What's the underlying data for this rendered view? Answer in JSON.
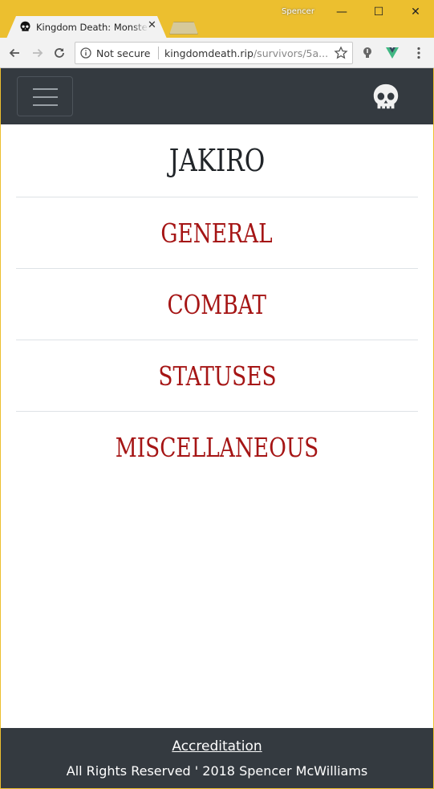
{
  "window": {
    "user": "Spencer",
    "minimize_glyph": "—",
    "maximize_glyph": "☐",
    "close_glyph": "✕"
  },
  "tab": {
    "title": "Kingdom Death: Monster",
    "close_glyph": "✕",
    "icon": "skull-icon"
  },
  "toolbar": {
    "security_label": "Not secure",
    "url_host": "kingdomdeath.rip",
    "url_path": "/survivors/5a...",
    "icons": [
      "back-arrow-icon",
      "forward-arrow-icon",
      "reload-icon",
      "info-icon",
      "star-icon",
      "lightbulb-extension-icon",
      "vue-extension-icon",
      "menu-dots-icon"
    ]
  },
  "navbar": {
    "toggle_icon": "hamburger-icon",
    "brand_icon": "skull-icon"
  },
  "survivor": {
    "name": "JAKIRO"
  },
  "menu": {
    "items": [
      {
        "label": "GENERAL"
      },
      {
        "label": "COMBAT"
      },
      {
        "label": "STATUSES"
      },
      {
        "label": "MISCELLANEOUS"
      }
    ]
  },
  "footer": {
    "link_label": "Accreditation",
    "copyright": "All Rights Reserved ' 2018 Spencer McWilliams"
  },
  "colors": {
    "window_frame": "#ecbf2f",
    "navbar_bg": "#343a40",
    "menu_text": "#a51515",
    "title_text": "#212529"
  }
}
